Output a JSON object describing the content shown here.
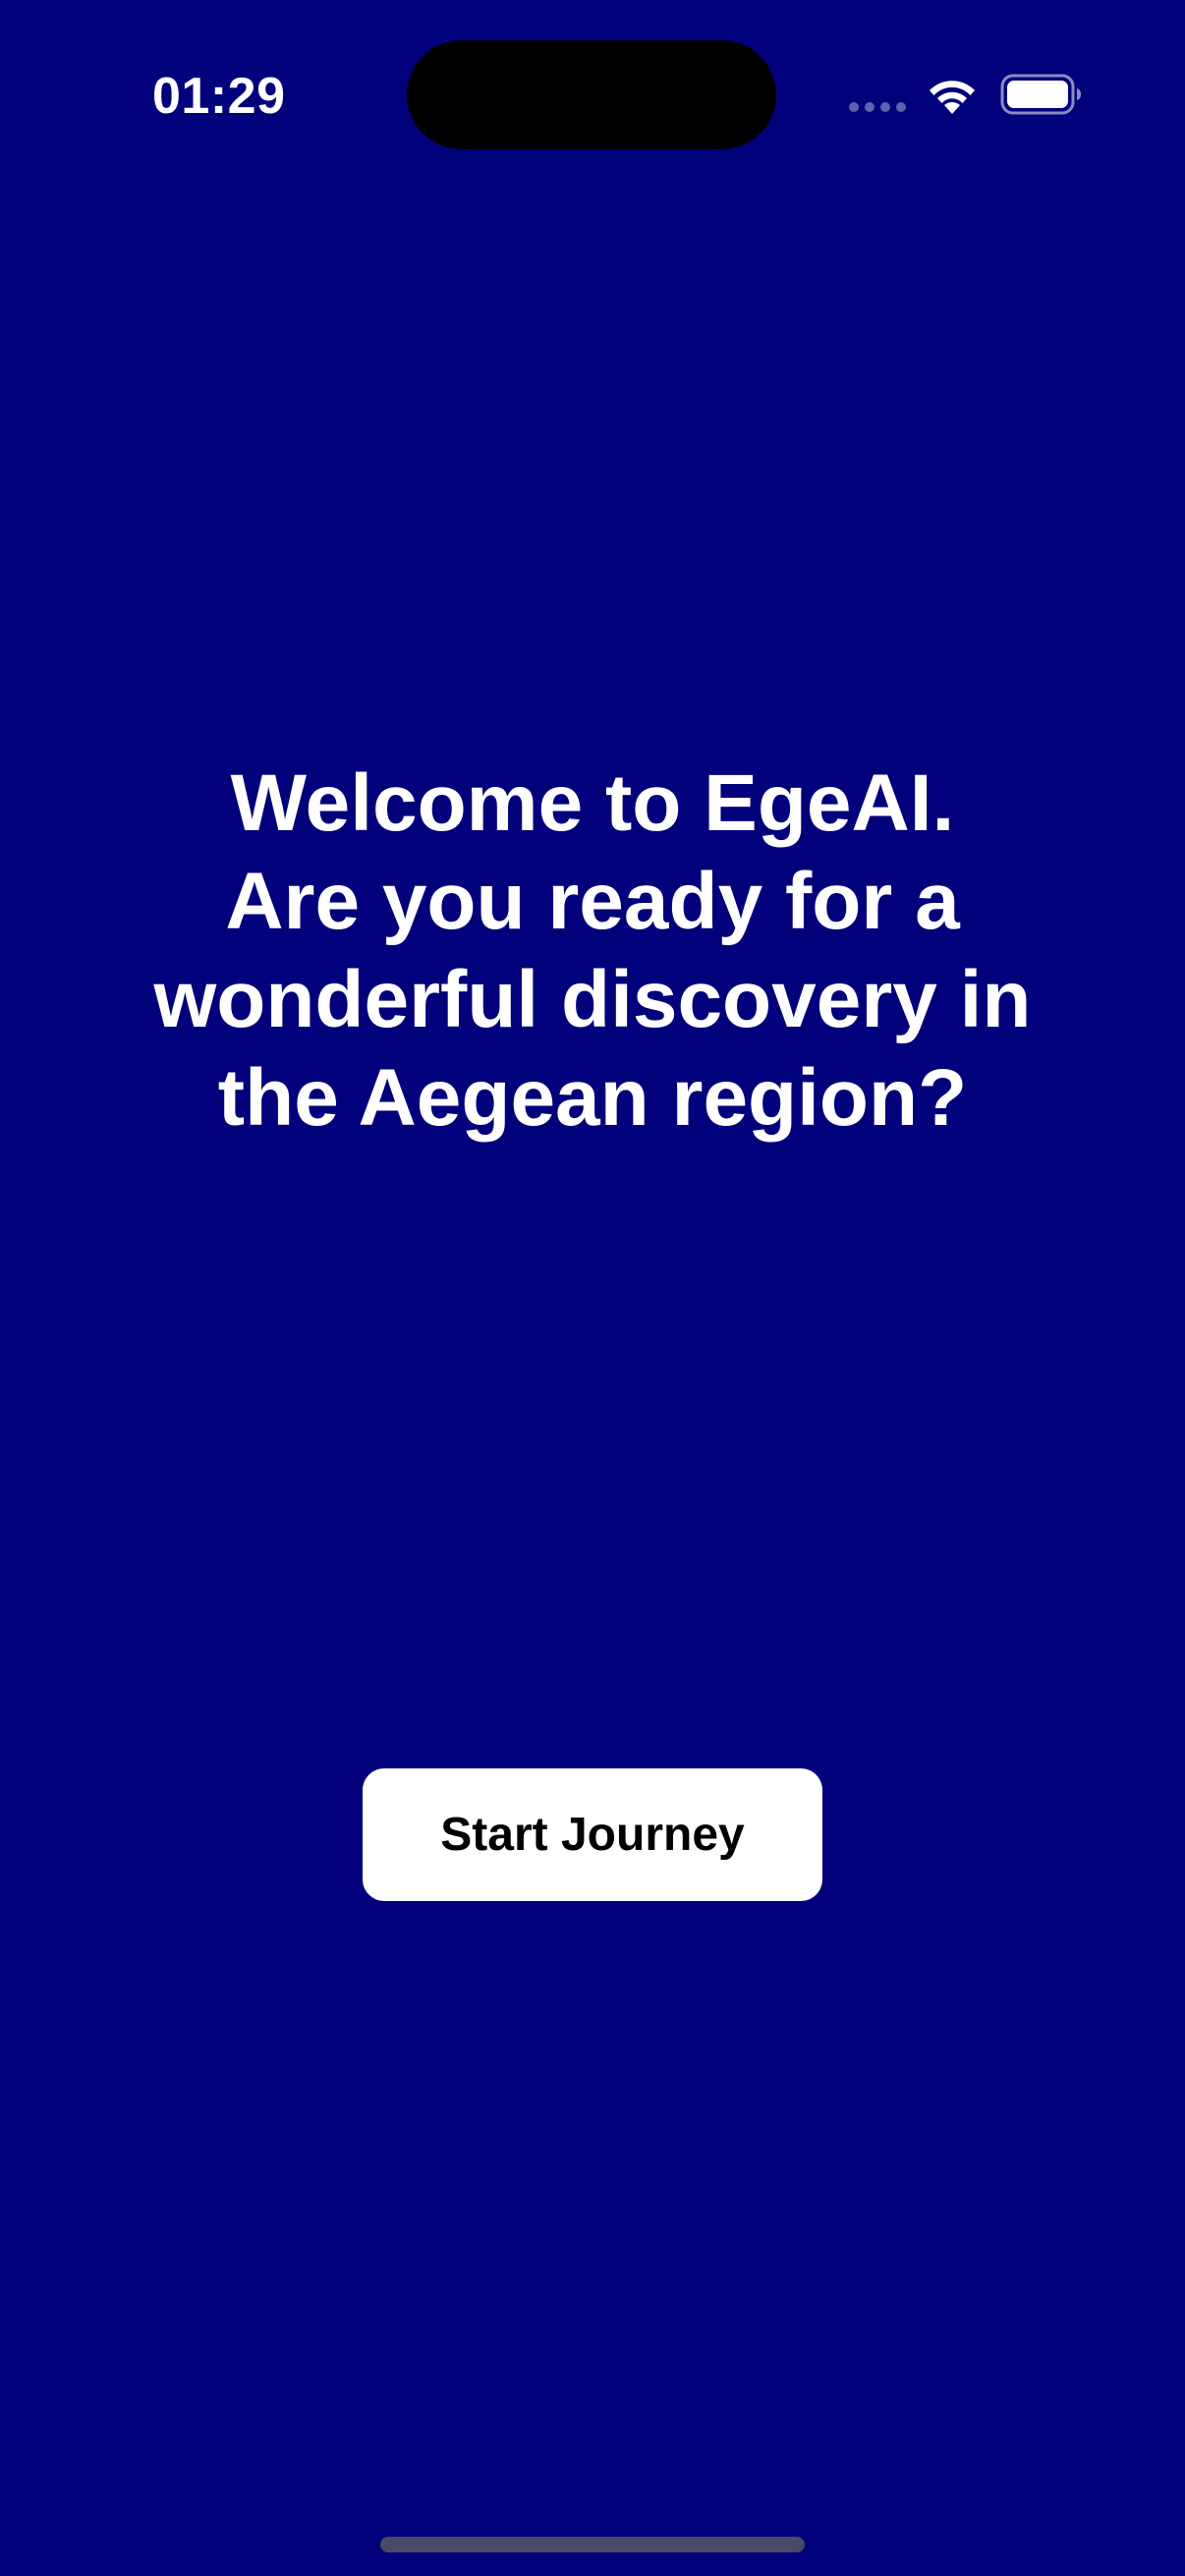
{
  "status_bar": {
    "time": "01:29",
    "signal_icon": "cellular-dots-icon",
    "wifi_icon": "wifi-icon",
    "battery_icon": "battery-icon"
  },
  "main": {
    "welcome_message": "Welcome to EgeAI.\nAre you ready for a\nwonderful discovery in\nthe Aegean region?",
    "start_button_label": "Start Journey"
  },
  "colors": {
    "background": "#01017B",
    "text": "#FFFFFF",
    "button_background": "#FFFFFF",
    "button_text": "#000000"
  }
}
